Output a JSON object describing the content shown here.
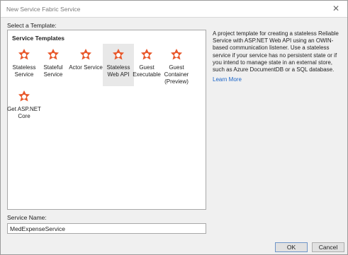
{
  "window": {
    "title": "New Service Fabric Service",
    "close_symbol": "✕"
  },
  "select_label": "Select a Template:",
  "templates_panel": {
    "heading": "Service Templates",
    "items": [
      {
        "label": "Stateless\nService",
        "icon": "service-fabric-icon",
        "selected": false
      },
      {
        "label": "Stateful\nService",
        "icon": "service-fabric-icon",
        "selected": false
      },
      {
        "label": "Actor Service",
        "icon": "service-fabric-icon",
        "selected": false
      },
      {
        "label": "Stateless\nWeb API",
        "icon": "service-fabric-icon",
        "selected": true
      },
      {
        "label": "Guest\nExecutable",
        "icon": "service-fabric-icon",
        "selected": false
      },
      {
        "label": "Guest\nContainer\n(Preview)",
        "icon": "service-fabric-icon",
        "selected": false
      },
      {
        "label": "Get ASP.NET\nCore",
        "icon": "service-fabric-icon",
        "selected": false
      }
    ]
  },
  "description": "A project template for creating a stateless Reliable Service with ASP.NET Web API using an OWIN-based communication listener. Use a stateless service if your service has no persistent state or if you intend to manage state in an external store, such as Azure DocumentDB or a SQL database.",
  "learn_more": "Learn More",
  "service_name": {
    "label": "Service Name:",
    "value": "MedExpenseService"
  },
  "buttons": {
    "ok": "OK",
    "cancel": "Cancel"
  },
  "colors": {
    "icon_orange": "#e8572a",
    "selection": "#e8e8e8",
    "link": "#1a64c8"
  }
}
